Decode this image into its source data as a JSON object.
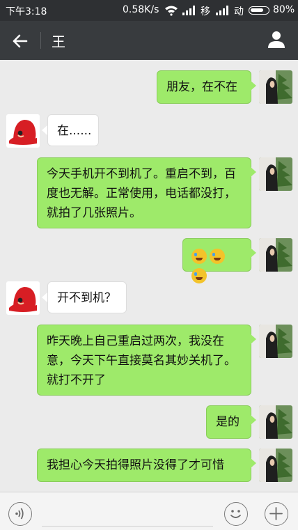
{
  "status_bar": {
    "time": "下午3:18",
    "net_speed": "0.58K/s",
    "carrier1": "移",
    "carrier2": "动",
    "battery_pct": "80%",
    "battery_level": 0.8
  },
  "title_bar": {
    "title": "王",
    "back_icon": "arrow-left-icon",
    "profile_icon": "person-icon"
  },
  "messages": [
    {
      "side": "out",
      "text": "朋友，在不在"
    },
    {
      "side": "in",
      "text": "在......"
    },
    {
      "side": "out",
      "lines": [
        "今天手机开不到机了。重启不到，百",
        "度也无解。正常使用，电话都没打，",
        "就拍了几张照片。"
      ]
    },
    {
      "side": "out",
      "emoji_count": 3
    },
    {
      "side": "in",
      "text": "开不到机？"
    },
    {
      "side": "out",
      "lines": [
        "昨天晚上自己重启过两次，我没在",
        "意，今天下午直接莫名其妙关机了。",
        "就打不开了"
      ]
    },
    {
      "side": "out",
      "text": "是的"
    },
    {
      "side": "out",
      "text": "我担心今天拍得照片没得了才可惜"
    }
  ],
  "bottom_bar": {
    "voice_icon": "voice-icon",
    "emoji_icon": "emoji-icon",
    "plus_icon": "plus-icon"
  },
  "colors": {
    "out_bubble": "#9eea6a",
    "in_bubble": "#ffffff",
    "title_bar": "#383b3e",
    "background": "#ebebeb"
  }
}
